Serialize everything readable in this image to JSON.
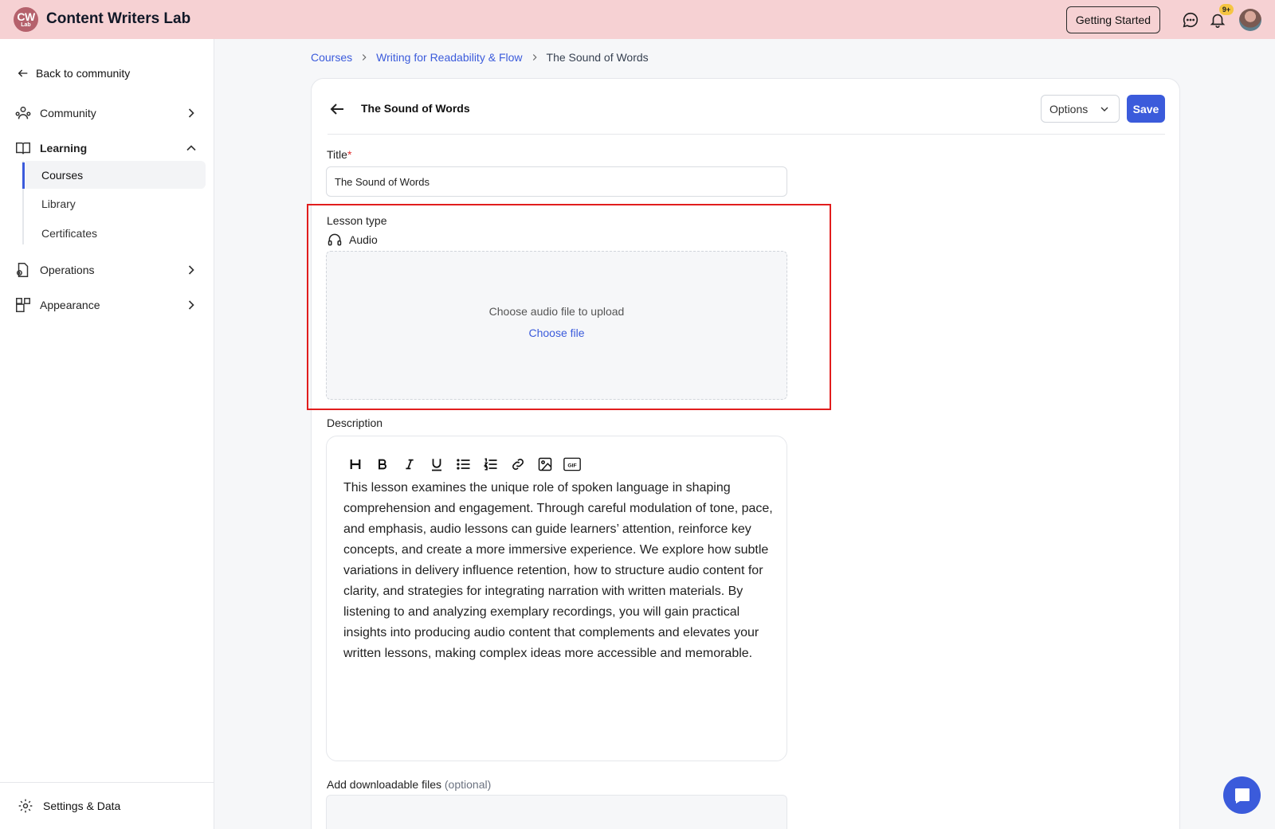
{
  "app": {
    "logo_line1": "CW",
    "logo_line2": "Lab",
    "name": "Content Writers Lab",
    "getting_started": "Getting Started",
    "notifications_badge": "9+"
  },
  "sidebar": {
    "back": "Back to community",
    "items": [
      {
        "label": "Community",
        "icon": "community-icon"
      },
      {
        "label": "Learning",
        "icon": "book-icon",
        "expanded": true
      },
      {
        "label": "Operations",
        "icon": "operations-icon"
      },
      {
        "label": "Appearance",
        "icon": "appearance-icon"
      }
    ],
    "sub_items": [
      {
        "label": "Courses",
        "active": true
      },
      {
        "label": "Library"
      },
      {
        "label": "Certificates"
      }
    ],
    "footer": "Settings & Data"
  },
  "breadcrumb": [
    "Courses",
    "Writing for Readability & Flow",
    "The Sound of Words"
  ],
  "lesson": {
    "header_title": "The Sound of Words",
    "options_label": "Options",
    "save_label": "Save",
    "title_label": "Title",
    "title_required_mark": "*",
    "title_value": "The Sound of Words",
    "lesson_type_label": "Lesson type",
    "lesson_type_value": "Audio",
    "upload_message": "Choose audio file to upload",
    "upload_button": "Choose file",
    "description_label": "Description",
    "description_toolbar": [
      "heading",
      "bold",
      "italic",
      "underline",
      "bullet-list",
      "numbered-list",
      "link",
      "image",
      "gif"
    ],
    "gif_label": "GIF",
    "description_text": "This lesson examines the unique role of spoken language in shaping comprehension and engagement. Through careful modulation of tone, pace, and emphasis, audio lessons can guide learners’ attention, reinforce key concepts, and create a more immersive experience. We explore how subtle variations in delivery influence retention, how to structure audio content for clarity, and strategies for integrating narration with written materials. By listening to and analyzing exemplary recordings, you will gain practical insights into producing audio content that complements and elevates your written lessons, making complex ideas more accessible and memorable.",
    "downloads_label": "Add downloadable files",
    "downloads_optional": "(optional)"
  },
  "colors": {
    "topbar": "#f6d1d3",
    "accent": "#3b5bdb",
    "highlight": "#e11d1d"
  }
}
